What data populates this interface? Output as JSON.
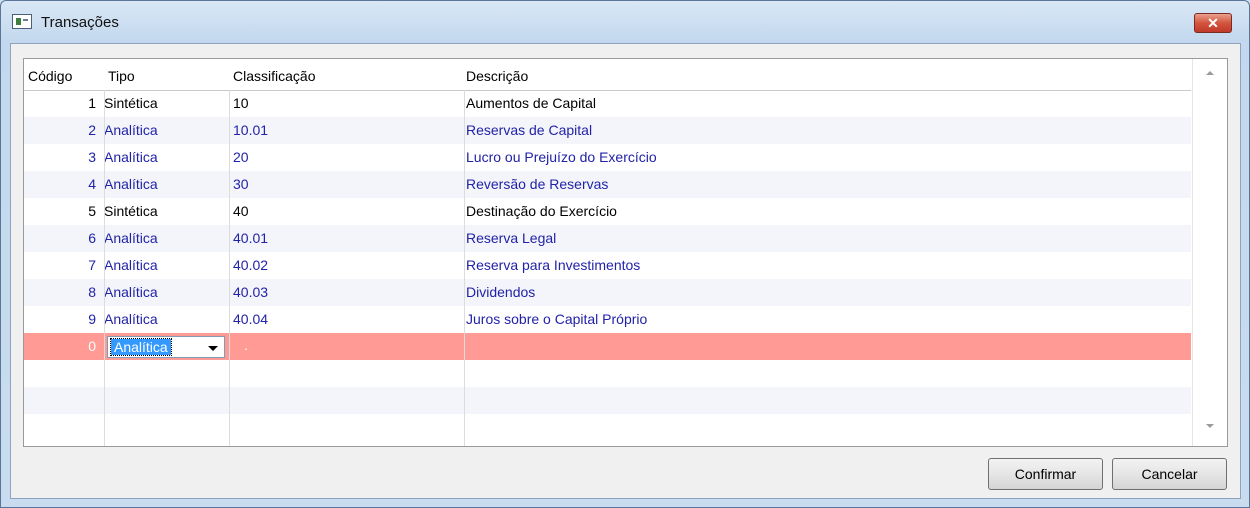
{
  "window": {
    "title": "Transações",
    "close_glyph": "✕"
  },
  "grid": {
    "columns": [
      "Código",
      "Tipo",
      "Classificação",
      "Descrição"
    ],
    "rows": [
      {
        "codigo": "1",
        "tipo": "Sintética",
        "classificacao": "10",
        "descricao": "Aumentos de Capital",
        "color": "black"
      },
      {
        "codigo": "2",
        "tipo": "Analítica",
        "classificacao": "10.01",
        "descricao": "Reservas de Capital",
        "color": "blue"
      },
      {
        "codigo": "3",
        "tipo": "Analítica",
        "classificacao": "20",
        "descricao": "Lucro ou Prejuízo do Exercício",
        "color": "blue"
      },
      {
        "codigo": "4",
        "tipo": "Analítica",
        "classificacao": "30",
        "descricao": "Reversão de Reservas",
        "color": "blue"
      },
      {
        "codigo": "5",
        "tipo": "Sintética",
        "classificacao": "40",
        "descricao": "Destinação do Exercício",
        "color": "black"
      },
      {
        "codigo": "6",
        "tipo": "Analítica",
        "classificacao": "40.01",
        "descricao": "Reserva Legal",
        "color": "blue"
      },
      {
        "codigo": "7",
        "tipo": "Analítica",
        "classificacao": "40.02",
        "descricao": "Reserva para Investimentos",
        "color": "blue"
      },
      {
        "codigo": "8",
        "tipo": "Analítica",
        "classificacao": "40.03",
        "descricao": "Dividendos",
        "color": "blue"
      },
      {
        "codigo": "9",
        "tipo": "Analítica",
        "classificacao": "40.04",
        "descricao": "Juros sobre o Capital Próprio",
        "color": "blue"
      }
    ],
    "new_row": {
      "codigo": "0",
      "tipo_selected": "Analítica",
      "classificacao": "."
    }
  },
  "buttons": {
    "confirm_label": "Confirmar",
    "cancel_label": "Cancelar"
  },
  "colors": {
    "selected_row": "#ff9a94",
    "blue_text": "#2222a8",
    "titlebar": "#c3d8ee"
  }
}
